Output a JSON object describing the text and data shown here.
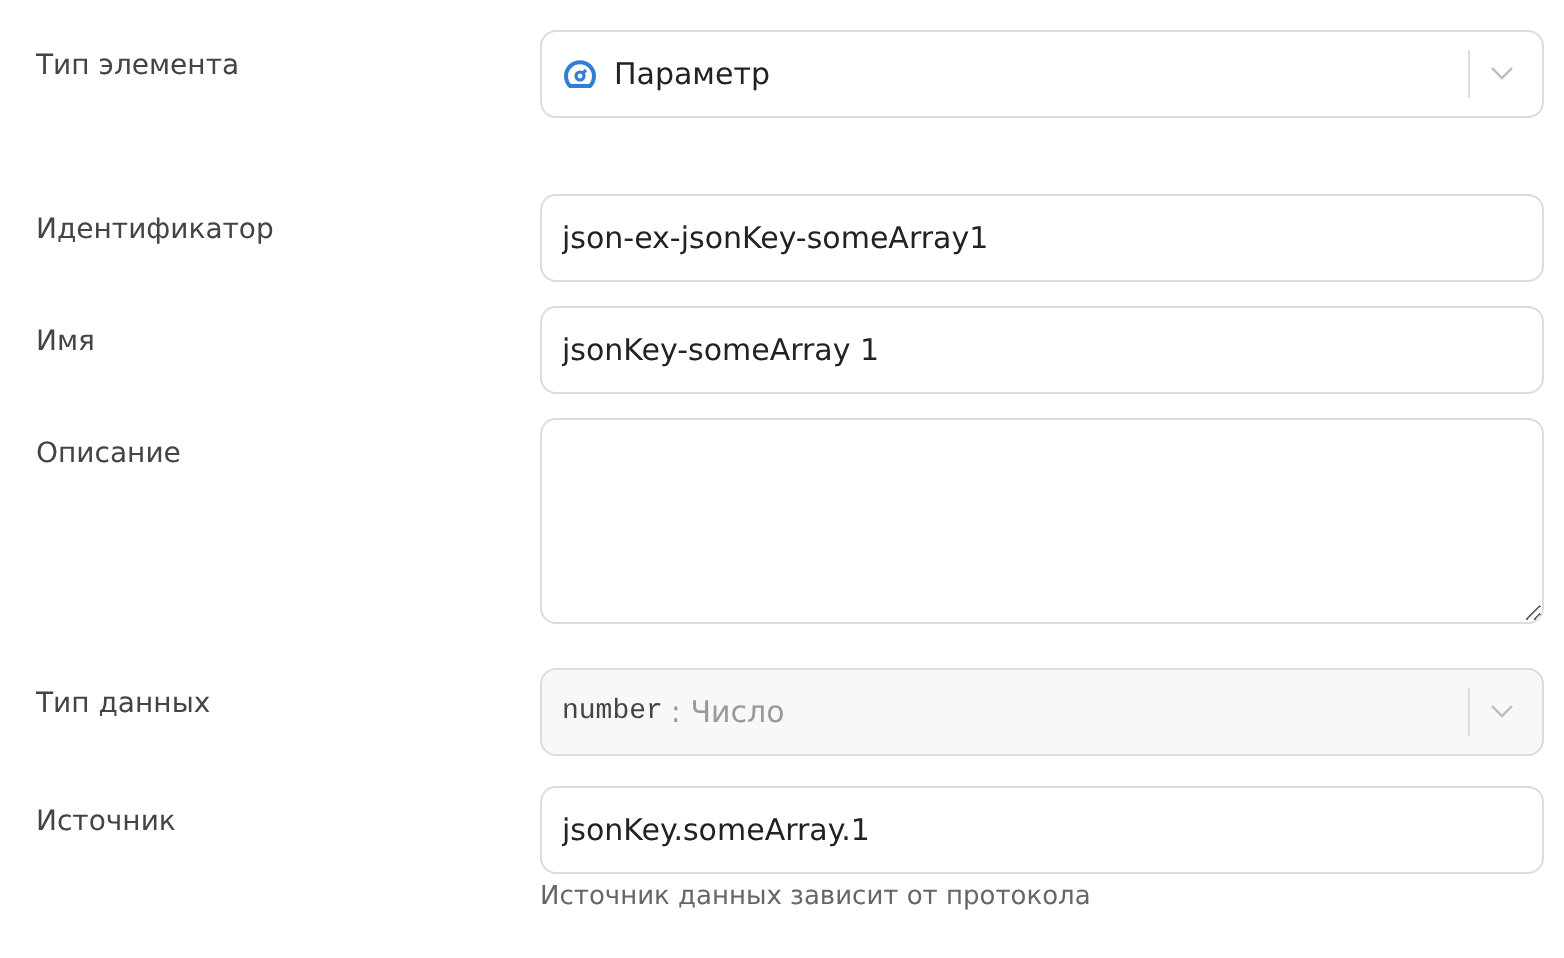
{
  "fields": [
    {
      "kind": "select",
      "label": "Тип элемента",
      "value": "Параметр",
      "disabled": false
    },
    {
      "kind": "input",
      "label": "Идентификатор",
      "value": "json-ex-jsonKey-someArray1"
    },
    {
      "kind": "input",
      "label": "Имя",
      "value": "jsonKey-someArray 1"
    },
    {
      "kind": "textarea",
      "label": "Описание"
    },
    {
      "kind": "select",
      "label": "Тип данных",
      "code": "number",
      "value": ": Число",
      "disabled": true
    },
    {
      "kind": "input",
      "label": "Источник",
      "value": "jsonKey.someArray.1",
      "hint": "Источник данных зависит от протокола"
    }
  ]
}
